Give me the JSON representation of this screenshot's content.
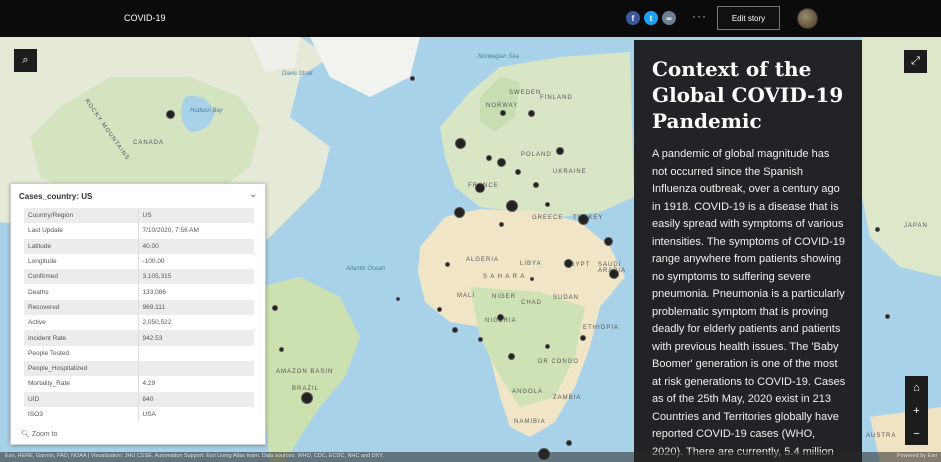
{
  "header": {
    "title": "COVID-19",
    "share": {
      "facebook": "f",
      "twitter": "t",
      "link": "∞"
    },
    "more_label": "···",
    "edit_label": "Edit story"
  },
  "map": {
    "labels": {
      "canada": "CANADA",
      "hudson": "Hudson Bay",
      "davis": "Davis Strait",
      "norwegian": "Norwegian Sea",
      "atlantic": "Atlantic Ocean",
      "norway": "NORWAY",
      "sweden": "SWEDEN",
      "finland": "FINLAND",
      "poland": "POLAND",
      "ukraine": "UKRAINE",
      "france": "FRANCE",
      "turkey": "TURKEY",
      "greece": "GREECE",
      "algeria": "ALGERIA",
      "libya": "LIBYA",
      "egypt": "EGYPT",
      "saudi": "SAUDI ARABIA",
      "sahara": "S A H A R A",
      "mali": "MALI",
      "niger": "NIGER",
      "chad": "CHAD",
      "sudan": "SUDAN",
      "nigeria": "NIGERIA",
      "ethiopia": "ETHIOPIA",
      "drcongo": "DR CONGO",
      "angola": "ANGOLA",
      "zambia": "ZAMBIA",
      "namibia": "NAMIBIA",
      "brazil": "BRAZIL",
      "amazon": "AMAZON BASIN",
      "japan": "JAPAN",
      "australia": "AUSTRA",
      "rocky": "ROCKY MOUNTAINS"
    },
    "buttons": {
      "search": "⌕",
      "expand": "⤢",
      "home": "⌂",
      "zoom_in": "+",
      "zoom_out": "−"
    },
    "attribution": "Esri, HERE, Garmin, FAO, NOAA | Visualization: JHU CSSE. Automation Support: Esri Living Atlas team. Data sources: WHO, CDC, ECDC, NHC and DXY.",
    "powered": "Powered by Esri"
  },
  "popup": {
    "title": "Cases_country: US",
    "collapse": "⌄",
    "rows": [
      {
        "key": "Country/Region",
        "value": "US"
      },
      {
        "key": "Last Update",
        "value": "7/10/2020, 7:56 AM"
      },
      {
        "key": "Latitude",
        "value": "40.00"
      },
      {
        "key": "Longitude",
        "value": "-100.00"
      },
      {
        "key": "Confirmed",
        "value": "3,105,315"
      },
      {
        "key": "Deaths",
        "value": "133,086"
      },
      {
        "key": "Recovered",
        "value": "969,111"
      },
      {
        "key": "Active",
        "value": "2,050,522"
      },
      {
        "key": "Incident Rate",
        "value": "942.53"
      },
      {
        "key": "People Tested",
        "value": ""
      },
      {
        "key": "People_Hospitalized",
        "value": ""
      },
      {
        "key": "Mortality_Rate",
        "value": "4.29"
      },
      {
        "key": "UID",
        "value": "840"
      },
      {
        "key": "ISO3",
        "value": "USA"
      }
    ],
    "zoom_to": "Zoom to"
  },
  "story": {
    "heading": "Context of the Global COVID-19 Pandemic",
    "body": "A pandemic of global magnitude has not occurred since the Spanish Influenza outbreak, over a century ago in 1918. COVID-19 is a disease that is easily spread with symptoms of various intensities. The symptoms of COVID-19 range anywhere from patients showing no symptoms to suffering severe pneumonia. Pneumonia is a particularly problematic symptom that is proving deadly for elderly patients and patients with previous health issues. The 'Baby Boomer' generation is one of the most at risk generations to COVID-19. Cases as of the 25th May, 2020 exist in 213 Countries and Territories globally have reported COVID-19 cases (WHO, 2020). There are currently, 5.4 million"
  }
}
